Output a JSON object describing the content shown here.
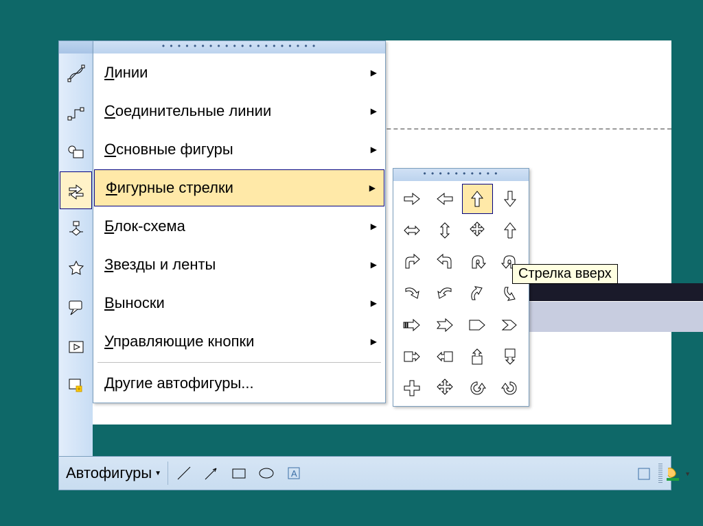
{
  "bottom_toolbar": {
    "autofigures_label": "Автофигуры",
    "tools": [
      "line",
      "arrow",
      "rectangle",
      "oval",
      "textbox"
    ]
  },
  "side_icons": [
    "lines",
    "connectors",
    "basic-shapes",
    "block-arrows",
    "flowchart",
    "stars",
    "callouts",
    "action-buttons",
    "more-autoshapes"
  ],
  "menu": {
    "items": [
      {
        "label_pre": "",
        "ul": "Л",
        "label_post": "инии",
        "has_sub": true,
        "icon": "lines"
      },
      {
        "label_pre": "",
        "ul": "С",
        "label_post": "оединительные линии",
        "has_sub": true,
        "icon": "connectors"
      },
      {
        "label_pre": "",
        "ul": "О",
        "label_post": "сновные фигуры",
        "has_sub": true,
        "icon": "basic-shapes"
      },
      {
        "label_pre": "",
        "ul": "Ф",
        "label_post": "игурные стрелки",
        "has_sub": true,
        "icon": "block-arrows",
        "hovered": true
      },
      {
        "label_pre": "",
        "ul": "Б",
        "label_post": "лок-схема",
        "has_sub": true,
        "icon": "flowchart"
      },
      {
        "label_pre": "",
        "ul": "З",
        "label_post": "везды и ленты",
        "has_sub": true,
        "icon": "stars"
      },
      {
        "label_pre": "",
        "ul": "В",
        "label_post": "ыноски",
        "has_sub": true,
        "icon": "callouts"
      },
      {
        "label_pre": "",
        "ul": "У",
        "label_post": "правляющие кнопки",
        "has_sub": true,
        "icon": "action-buttons"
      },
      {
        "sep": true
      },
      {
        "label_pre": "",
        "ul": "Д",
        "label_post": "ругие автофигуры...",
        "has_sub": false,
        "icon": "more-autoshapes"
      }
    ]
  },
  "submenu": {
    "shapes": [
      "right-arrow",
      "left-arrow",
      "up-arrow",
      "down-arrow",
      "left-right-arrow",
      "up-down-arrow",
      "quad-arrow",
      "up-hollow-arrow",
      "bent-arrow-right",
      "bent-arrow-left",
      "u-turn-left",
      "u-turn-right",
      "curved-right",
      "curved-left",
      "curved-up",
      "curved-down",
      "striped-right",
      "notched-right",
      "pentagon",
      "chevron",
      "right-callout",
      "left-callout",
      "up-callout",
      "down-callout",
      "plus-arrow",
      "cross-arrows",
      "circular-arrow",
      "circular-arrow-2"
    ],
    "hovered_index": 2
  },
  "tooltip": "Стрелка вверх"
}
